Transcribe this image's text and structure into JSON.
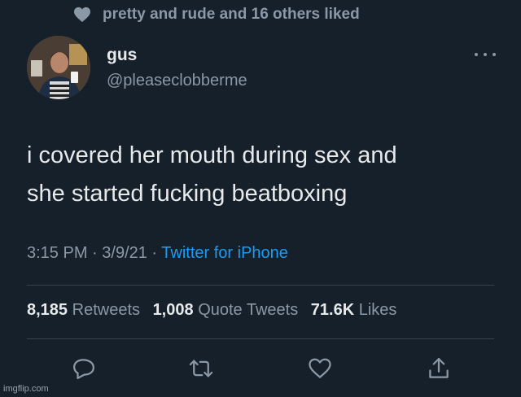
{
  "social_context": {
    "text": "pretty and rude and 16 others liked",
    "icon": "heart-icon"
  },
  "author": {
    "name": "gus",
    "handle": "@pleaseclobberme"
  },
  "tweet": {
    "lines": [
      "i covered her mouth during sex and",
      "she started fucking beatboxing"
    ]
  },
  "meta": {
    "time": "3:15 PM",
    "sep1": " · ",
    "date": "3/9/21",
    "sep2": " · ",
    "source": "Twitter for iPhone"
  },
  "stats": {
    "retweets_count": "8,185",
    "retweets_label": "Retweets",
    "quotes_count": "1,008",
    "quotes_label": "Quote Tweets",
    "likes_count": "71.6K",
    "likes_label": "Likes"
  },
  "actions": [
    "reply-icon",
    "retweet-icon",
    "like-icon",
    "share-icon"
  ],
  "watermark": "imgflip.com",
  "colors": {
    "background": "#15202b",
    "secondary_text": "#8b98a5",
    "link": "#1d9bf0"
  }
}
